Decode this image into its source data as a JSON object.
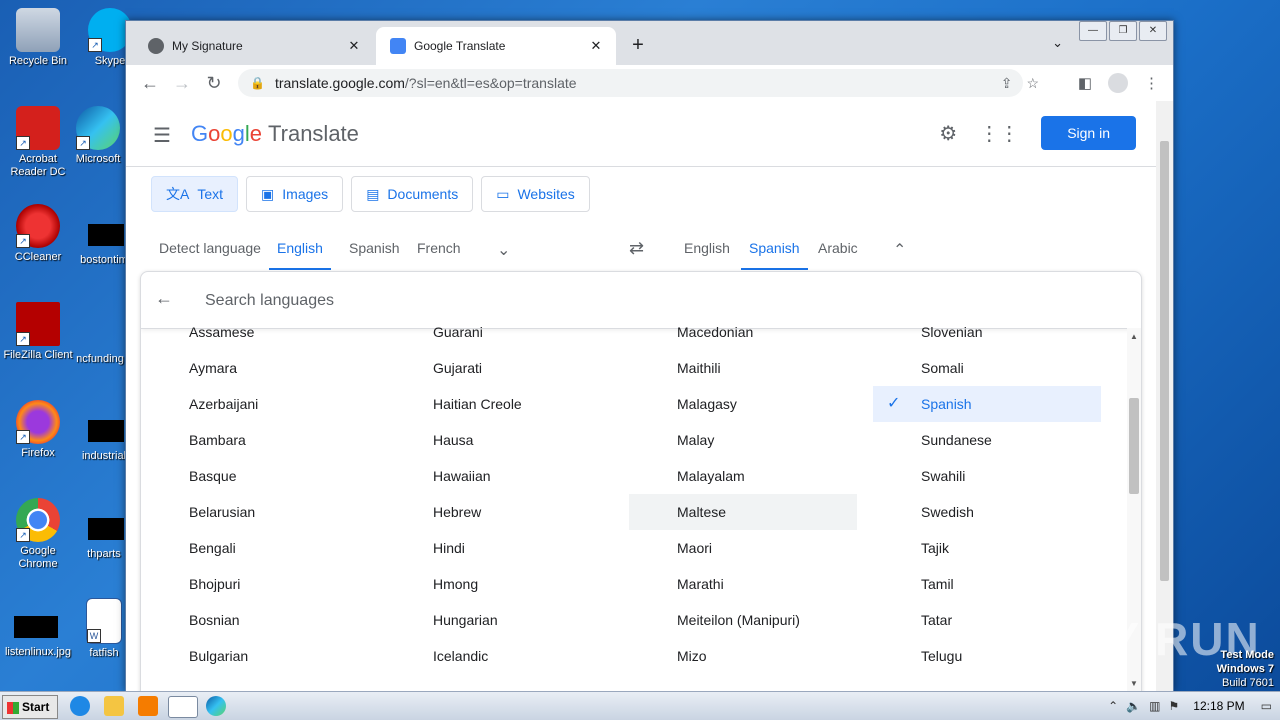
{
  "desktop": {
    "icons": [
      {
        "label": "Recycle Bin"
      },
      {
        "label": "Skype"
      },
      {
        "label": "Acrobat Reader DC"
      },
      {
        "label": "Microsoft"
      },
      {
        "label": "CCleaner"
      },
      {
        "label": "bostontim"
      },
      {
        "label": "FileZilla Client"
      },
      {
        "label": "ncfunding"
      },
      {
        "label": "Firefox"
      },
      {
        "label": "industrial"
      },
      {
        "label": "Google Chrome"
      },
      {
        "label": "thparts"
      },
      {
        "label": "listenlinux.jpg"
      },
      {
        "label": "fatfish"
      }
    ]
  },
  "browser": {
    "tabs": [
      {
        "title": "My Signature",
        "active": false
      },
      {
        "title": "Google Translate",
        "active": true
      }
    ],
    "url_host": "translate.google.com",
    "url_path": "/?sl=en&tl=es&op=translate"
  },
  "header": {
    "logo_letters": [
      "G",
      "o",
      "o",
      "g",
      "l",
      "e"
    ],
    "product": "Translate",
    "signin_label": "Sign in"
  },
  "modes": [
    {
      "label": "Text",
      "icon": "translate-icon",
      "selected": true
    },
    {
      "label": "Images",
      "icon": "image-icon",
      "selected": false
    },
    {
      "label": "Documents",
      "icon": "document-icon",
      "selected": false
    },
    {
      "label": "Websites",
      "icon": "website-icon",
      "selected": false
    }
  ],
  "source_langs": [
    "Detect language",
    "English",
    "Spanish",
    "French"
  ],
  "target_langs": [
    "English",
    "Spanish",
    "Arabic"
  ],
  "search": {
    "placeholder": "Search languages"
  },
  "language_columns": [
    [
      "Assamese",
      "Aymara",
      "Azerbaijani",
      "Bambara",
      "Basque",
      "Belarusian",
      "Bengali",
      "Bhojpuri",
      "Bosnian",
      "Bulgarian"
    ],
    [
      "Guarani",
      "Gujarati",
      "Haitian Creole",
      "Hausa",
      "Hawaiian",
      "Hebrew",
      "Hindi",
      "Hmong",
      "Hungarian",
      "Icelandic"
    ],
    [
      "Macedonian",
      "Maithili",
      "Malagasy",
      "Malay",
      "Malayalam",
      "Maltese",
      "Maori",
      "Marathi",
      "Meiteilon (Manipuri)",
      "Mizo"
    ],
    [
      "Slovenian",
      "Somali",
      "Spanish",
      "Sundanese",
      "Swahili",
      "Swedish",
      "Tajik",
      "Tamil",
      "Tatar",
      "Telugu"
    ]
  ],
  "selected_language": "Spanish",
  "hovered_language": "Maltese",
  "watermark": "ANY RUN",
  "test_mode": [
    "Test Mode",
    "Windows 7",
    "Build 7601"
  ],
  "taskbar": {
    "start_label": "Start",
    "clock": "12:18 PM"
  }
}
